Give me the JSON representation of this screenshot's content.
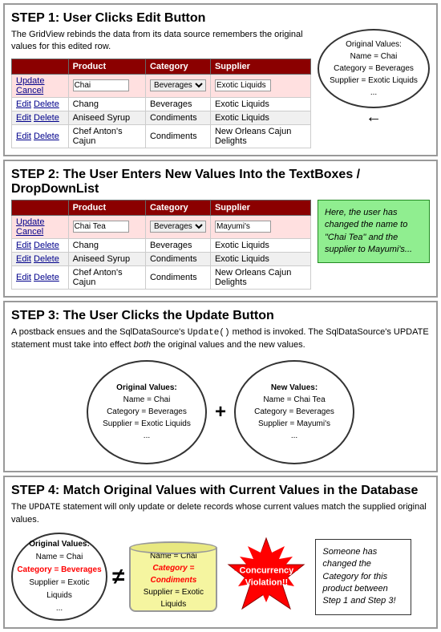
{
  "step1": {
    "title": "STEP 1: User Clicks Edit Button",
    "description": "The GridView rebinds the data from its data source remembers the original values for this edited row.",
    "table": {
      "headers": [
        "Product",
        "Category",
        "Supplier"
      ],
      "rows": [
        {
          "type": "edit",
          "cols": [
            "Update Cancel",
            "Chai",
            "Beverages",
            "Exotic Liquids"
          ]
        },
        {
          "type": "normal",
          "cols": [
            "Edit Delete",
            "Chang",
            "Beverages",
            "Exotic Liquids"
          ]
        },
        {
          "type": "normal",
          "cols": [
            "Edit Delete",
            "Aniseed Syrup",
            "Condiments",
            "Exotic Liquids"
          ]
        },
        {
          "type": "normal",
          "cols": [
            "Edit Delete",
            "Chef Anton's Cajun",
            "Condiments",
            "New Orleans Cajun Delights"
          ]
        }
      ]
    },
    "bubble": {
      "text": "Original Values:\nName = Chai\nCategory = Beverages\nSupplier = Exotic Liquids\n..."
    }
  },
  "step2": {
    "title": "STEP 2: The User Enters New Values Into the TextBoxes / DropDownList",
    "table": {
      "headers": [
        "Product",
        "Category",
        "Supplier"
      ],
      "rows": [
        {
          "type": "edit",
          "cols": [
            "Update Cancel",
            "Chai Tea",
            "Beverages",
            "Mayumi's"
          ]
        },
        {
          "type": "normal",
          "cols": [
            "Edit Delete",
            "Chang",
            "Beverages",
            "Exotic Liquids"
          ]
        },
        {
          "type": "normal",
          "cols": [
            "Edit Delete",
            "Aniseed Syrup",
            "Condiments",
            "Exotic Liquids"
          ]
        },
        {
          "type": "normal",
          "cols": [
            "Edit Delete",
            "Chef Anton's Cajun",
            "Condiments",
            "New Orleans Cajun Delights"
          ]
        }
      ]
    },
    "note": "Here, the user has changed the name to \"Chai Tea\" and the supplier to Mayumi's..."
  },
  "step3": {
    "title": "STEP 3: The User Clicks the Update Button",
    "description": "A postback ensues and the SqlDataSource's Update() method is invoked. The SqlDataSource's UPDATE statement must take into effect both the original values and the new values.",
    "original": "Original Values:\nName = Chai\nCategory = Beverages\nSupplier = Exotic Liquids\n...",
    "new_vals": "New Values:\nName = Chai Tea\nCategory = Beverages\nSupplier = Mayumi's\n..."
  },
  "step4": {
    "title": "STEP 4: Match Original Values with Current Values in the Database",
    "description": "The UPDATE statement will only update or delete records whose current values match the supplied original values.",
    "original_oval": "Original Values:\nName = Chai\nCategory = Beverages\nSupplier = Exotic Liquids\n...",
    "category_label": "Category = Beverages",
    "db_values": "Name = Chai\nCategory = Condiments\nSupplier = Exotic Liquids",
    "db_category": "Category = Condiments",
    "concurrency_title": "Concurrency\nViolation!!",
    "note": "Someone has changed the Category for this product between Step 1 and Step 3!"
  }
}
